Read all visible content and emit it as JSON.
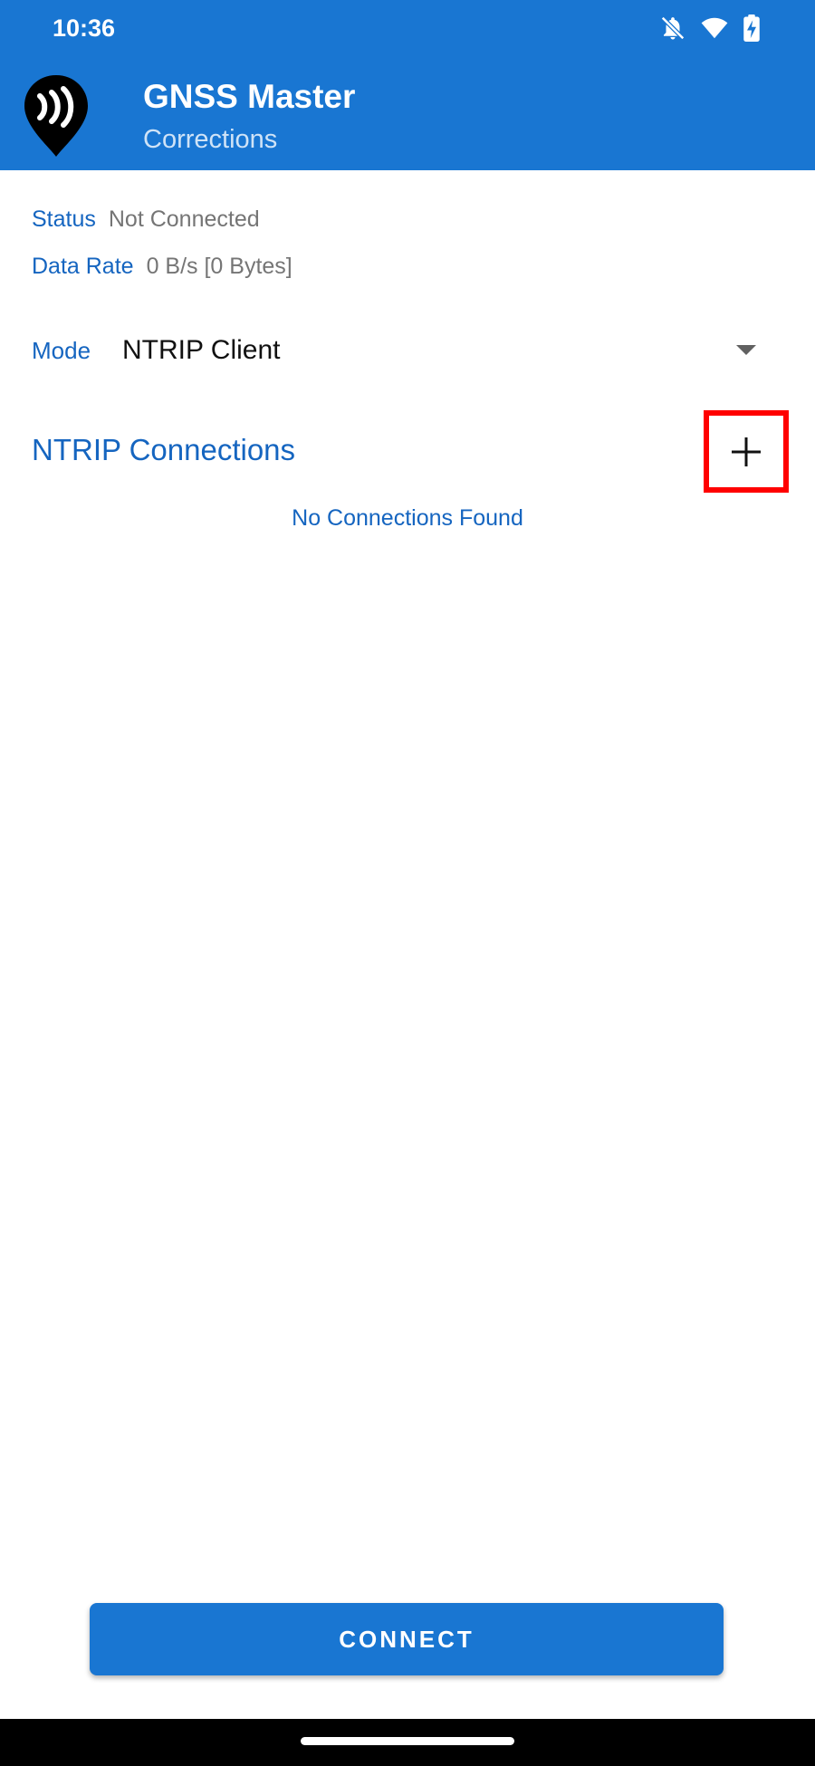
{
  "status_bar": {
    "time": "10:36",
    "icons": [
      "bell-off-icon",
      "wifi-icon",
      "battery-charging-icon"
    ]
  },
  "header": {
    "title": "GNSS Master",
    "subtitle": "Corrections",
    "logo_icon": "gnss-logo-icon"
  },
  "info": {
    "status_label": "Status",
    "status_value": "Not Connected",
    "rate_label": "Data Rate",
    "rate_value": "0 B/s [0 Bytes]"
  },
  "mode": {
    "label": "Mode",
    "selected": "NTRIP Client"
  },
  "connections": {
    "title": "NTRIP Connections",
    "add_icon": "plus-icon",
    "empty_text": "No Connections Found"
  },
  "footer": {
    "connect_label": "CONNECT"
  },
  "colors": {
    "primary": "#1976d2",
    "label_blue": "#1565c0",
    "highlight": "#ff0000"
  }
}
